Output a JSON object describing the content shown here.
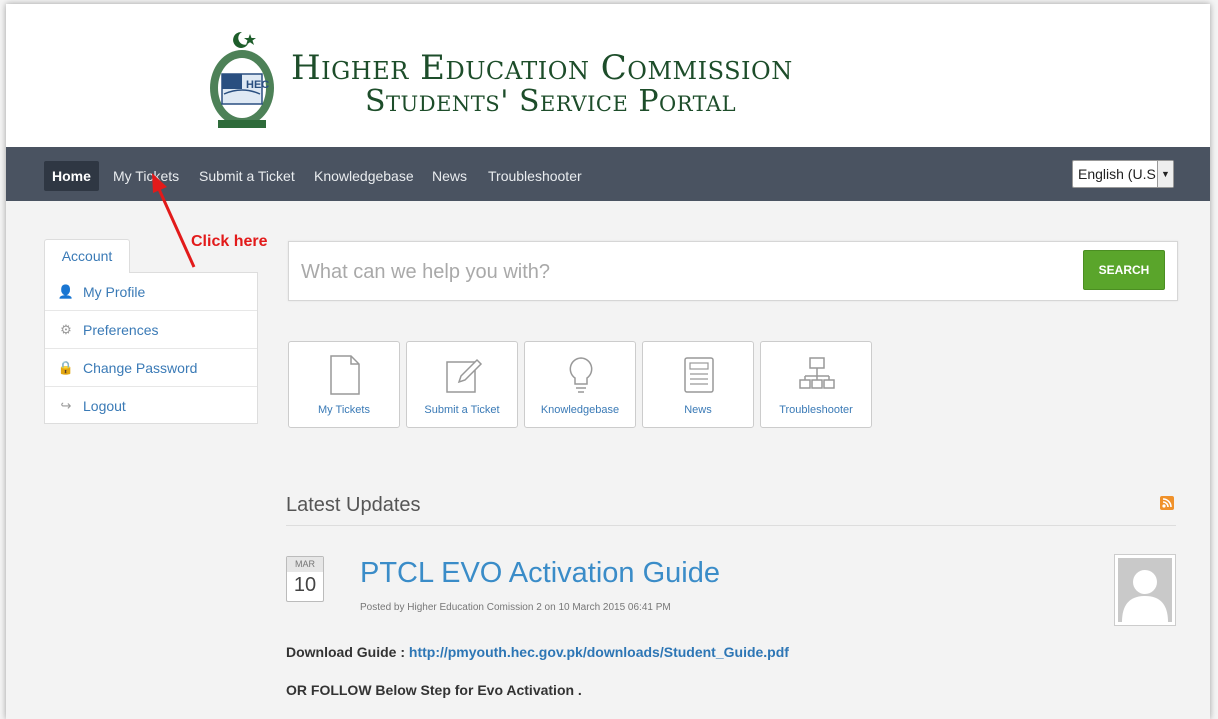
{
  "header": {
    "title_line1": "Higher Education Commission",
    "title_line2": "Students' Service Portal",
    "emblem_text": "HEC"
  },
  "nav": {
    "items": [
      {
        "label": "Home",
        "active": true
      },
      {
        "label": "My Tickets"
      },
      {
        "label": "Submit a Ticket"
      },
      {
        "label": "Knowledgebase"
      },
      {
        "label": "News"
      },
      {
        "label": "Troubleshooter"
      }
    ],
    "language": "English (U.S.)"
  },
  "annotation": {
    "text": "Click here",
    "color": "#e21a1a"
  },
  "account": {
    "tab_label": "Account",
    "items": [
      {
        "label": "My Profile",
        "icon": "user-icon"
      },
      {
        "label": "Preferences",
        "icon": "gear-icon"
      },
      {
        "label": "Change Password",
        "icon": "lock-icon"
      },
      {
        "label": "Logout",
        "icon": "logout-icon"
      }
    ]
  },
  "search": {
    "placeholder": "What can we help you with?",
    "button_label": "SEARCH"
  },
  "tiles": [
    {
      "label": "My Tickets",
      "icon": "document-icon"
    },
    {
      "label": "Submit a Ticket",
      "icon": "edit-icon"
    },
    {
      "label": "Knowledgebase",
      "icon": "lightbulb-icon"
    },
    {
      "label": "News",
      "icon": "newspaper-icon"
    },
    {
      "label": "Troubleshooter",
      "icon": "sitemap-icon"
    }
  ],
  "latest_updates": {
    "title": "Latest Updates",
    "post": {
      "month": "MAR",
      "day": "10",
      "title": "PTCL EVO Activation Guide",
      "meta": "Posted by Higher Education Comission 2 on 10 March 2015 06:41 PM",
      "download_label": "Download Guide : ",
      "download_link": "http://pmyouth.hec.gov.pk/downloads/Student_Guide.pdf",
      "follow_text": "OR FOLLOW Below Step for Evo Activation ."
    }
  },
  "colors": {
    "navbar": "#4a5361",
    "accent_green": "#5aa52b",
    "link_blue": "#3a7ab6",
    "title_green": "#1d4d2a"
  }
}
